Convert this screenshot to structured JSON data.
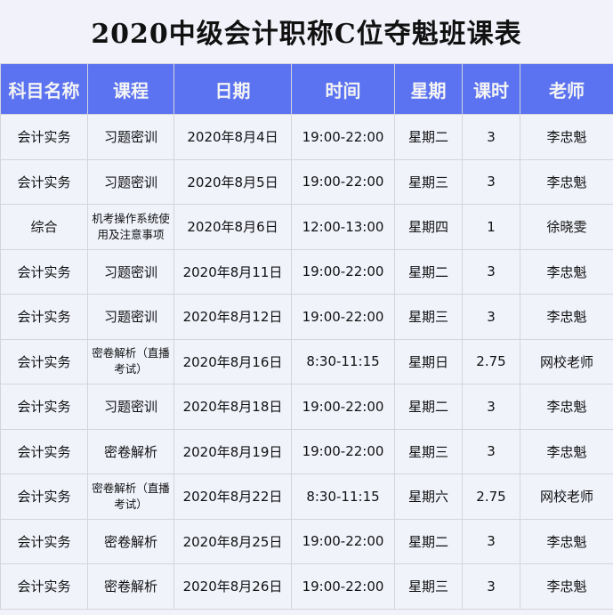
{
  "title": "2020中级会计职称C位夺魁班课表",
  "headers": [
    "科目名称",
    "课程",
    "日期",
    "时间",
    "星期",
    "课时",
    "老师"
  ],
  "rows": [
    [
      "会计实务",
      "习题密训",
      "2020年8月4日",
      "19:00-22:00",
      "星期二",
      "3",
      "李忠魁"
    ],
    [
      "会计实务",
      "习题密训",
      "2020年8月5日",
      "19:00-22:00",
      "星期三",
      "3",
      "李忠魁"
    ],
    [
      "综合",
      "机考操作系统使用及注意事项",
      "2020年8月6日",
      "12:00-13:00",
      "星期四",
      "1",
      "徐晓雯"
    ],
    [
      "会计实务",
      "习题密训",
      "2020年8月11日",
      "19:00-22:00",
      "星期二",
      "3",
      "李忠魁"
    ],
    [
      "会计实务",
      "习题密训",
      "2020年8月12日",
      "19:00-22:00",
      "星期三",
      "3",
      "李忠魁"
    ],
    [
      "会计实务",
      "密卷解析（直播考试）",
      "2020年8月16日",
      "8:30-11:15",
      "星期日",
      "2.75",
      "网校老师"
    ],
    [
      "会计实务",
      "习题密训",
      "2020年8月18日",
      "19:00-22:00",
      "星期二",
      "3",
      "李忠魁"
    ],
    [
      "会计实务",
      "密卷解析",
      "2020年8月19日",
      "19:00-22:00",
      "星期三",
      "3",
      "李忠魁"
    ],
    [
      "会计实务",
      "密卷解析（直播考试）",
      "2020年8月22日",
      "8:30-11:15",
      "星期六",
      "2.75",
      "网校老师"
    ],
    [
      "会计实务",
      "密卷解析",
      "2020年8月25日",
      "19:00-22:00",
      "星期二",
      "3",
      "李忠魁"
    ],
    [
      "会计实务",
      "密卷解析",
      "2020年8月26日",
      "19:00-22:00",
      "星期三",
      "3",
      "李忠魁"
    ]
  ],
  "colors": {
    "header": "#5b73f0",
    "background": "#f1f2fa"
  }
}
